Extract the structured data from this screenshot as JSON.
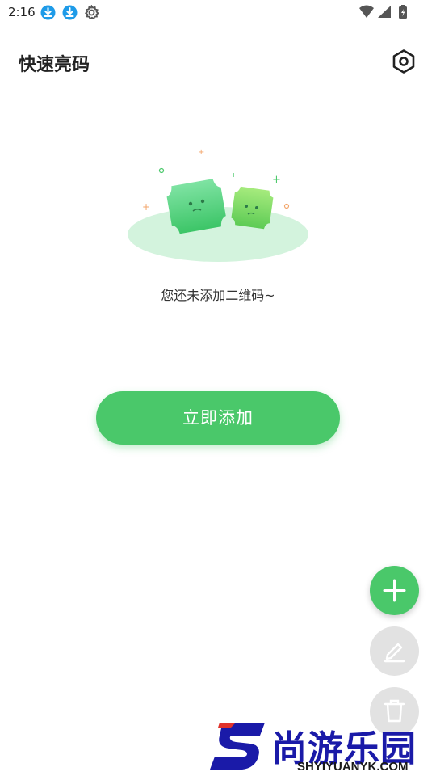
{
  "status_bar": {
    "time": "2:16",
    "left_icons": [
      "download-icon",
      "download-icon",
      "gear-icon"
    ],
    "right_icons": [
      "wifi-icon",
      "signal-icon",
      "battery-icon"
    ]
  },
  "header": {
    "title": "快速亮码",
    "settings_icon": "hexagon-settings-icon"
  },
  "empty_state": {
    "message": "您还未添加二维码~"
  },
  "primary_action": {
    "label": "立即添加"
  },
  "fabs": {
    "add_icon": "plus-icon",
    "edit_icon": "pencil-icon",
    "delete_icon": "trash-icon"
  },
  "watermark": {
    "title": "尚游乐园",
    "url": "SHYIYUANYK.COM"
  },
  "colors": {
    "accent": "#4ac86a",
    "fab_disabled": "#e2e2e2",
    "text_primary": "#222222",
    "status_blue": "#1e9be8"
  }
}
